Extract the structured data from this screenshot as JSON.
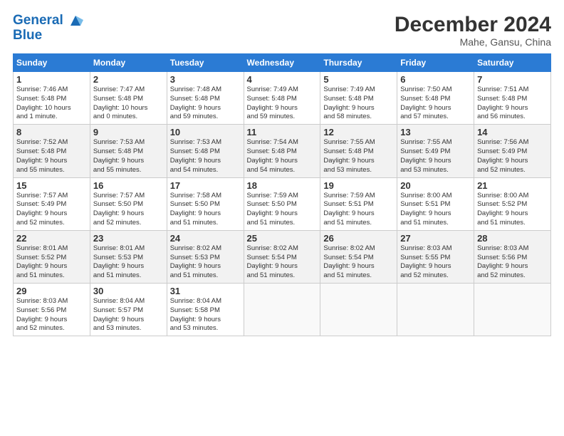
{
  "header": {
    "logo_line1": "General",
    "logo_line2": "Blue",
    "title": "December 2024",
    "location": "Mahe, Gansu, China"
  },
  "columns": [
    "Sunday",
    "Monday",
    "Tuesday",
    "Wednesday",
    "Thursday",
    "Friday",
    "Saturday"
  ],
  "weeks": [
    [
      {
        "day": "1",
        "info": "Sunrise: 7:46 AM\nSunset: 5:48 PM\nDaylight: 10 hours\nand 1 minute."
      },
      {
        "day": "2",
        "info": "Sunrise: 7:47 AM\nSunset: 5:48 PM\nDaylight: 10 hours\nand 0 minutes."
      },
      {
        "day": "3",
        "info": "Sunrise: 7:48 AM\nSunset: 5:48 PM\nDaylight: 9 hours\nand 59 minutes."
      },
      {
        "day": "4",
        "info": "Sunrise: 7:49 AM\nSunset: 5:48 PM\nDaylight: 9 hours\nand 59 minutes."
      },
      {
        "day": "5",
        "info": "Sunrise: 7:49 AM\nSunset: 5:48 PM\nDaylight: 9 hours\nand 58 minutes."
      },
      {
        "day": "6",
        "info": "Sunrise: 7:50 AM\nSunset: 5:48 PM\nDaylight: 9 hours\nand 57 minutes."
      },
      {
        "day": "7",
        "info": "Sunrise: 7:51 AM\nSunset: 5:48 PM\nDaylight: 9 hours\nand 56 minutes."
      }
    ],
    [
      {
        "day": "8",
        "info": "Sunrise: 7:52 AM\nSunset: 5:48 PM\nDaylight: 9 hours\nand 55 minutes."
      },
      {
        "day": "9",
        "info": "Sunrise: 7:53 AM\nSunset: 5:48 PM\nDaylight: 9 hours\nand 55 minutes."
      },
      {
        "day": "10",
        "info": "Sunrise: 7:53 AM\nSunset: 5:48 PM\nDaylight: 9 hours\nand 54 minutes."
      },
      {
        "day": "11",
        "info": "Sunrise: 7:54 AM\nSunset: 5:48 PM\nDaylight: 9 hours\nand 54 minutes."
      },
      {
        "day": "12",
        "info": "Sunrise: 7:55 AM\nSunset: 5:48 PM\nDaylight: 9 hours\nand 53 minutes."
      },
      {
        "day": "13",
        "info": "Sunrise: 7:55 AM\nSunset: 5:49 PM\nDaylight: 9 hours\nand 53 minutes."
      },
      {
        "day": "14",
        "info": "Sunrise: 7:56 AM\nSunset: 5:49 PM\nDaylight: 9 hours\nand 52 minutes."
      }
    ],
    [
      {
        "day": "15",
        "info": "Sunrise: 7:57 AM\nSunset: 5:49 PM\nDaylight: 9 hours\nand 52 minutes."
      },
      {
        "day": "16",
        "info": "Sunrise: 7:57 AM\nSunset: 5:50 PM\nDaylight: 9 hours\nand 52 minutes."
      },
      {
        "day": "17",
        "info": "Sunrise: 7:58 AM\nSunset: 5:50 PM\nDaylight: 9 hours\nand 51 minutes."
      },
      {
        "day": "18",
        "info": "Sunrise: 7:59 AM\nSunset: 5:50 PM\nDaylight: 9 hours\nand 51 minutes."
      },
      {
        "day": "19",
        "info": "Sunrise: 7:59 AM\nSunset: 5:51 PM\nDaylight: 9 hours\nand 51 minutes."
      },
      {
        "day": "20",
        "info": "Sunrise: 8:00 AM\nSunset: 5:51 PM\nDaylight: 9 hours\nand 51 minutes."
      },
      {
        "day": "21",
        "info": "Sunrise: 8:00 AM\nSunset: 5:52 PM\nDaylight: 9 hours\nand 51 minutes."
      }
    ],
    [
      {
        "day": "22",
        "info": "Sunrise: 8:01 AM\nSunset: 5:52 PM\nDaylight: 9 hours\nand 51 minutes."
      },
      {
        "day": "23",
        "info": "Sunrise: 8:01 AM\nSunset: 5:53 PM\nDaylight: 9 hours\nand 51 minutes."
      },
      {
        "day": "24",
        "info": "Sunrise: 8:02 AM\nSunset: 5:53 PM\nDaylight: 9 hours\nand 51 minutes."
      },
      {
        "day": "25",
        "info": "Sunrise: 8:02 AM\nSunset: 5:54 PM\nDaylight: 9 hours\nand 51 minutes."
      },
      {
        "day": "26",
        "info": "Sunrise: 8:02 AM\nSunset: 5:54 PM\nDaylight: 9 hours\nand 51 minutes."
      },
      {
        "day": "27",
        "info": "Sunrise: 8:03 AM\nSunset: 5:55 PM\nDaylight: 9 hours\nand 52 minutes."
      },
      {
        "day": "28",
        "info": "Sunrise: 8:03 AM\nSunset: 5:56 PM\nDaylight: 9 hours\nand 52 minutes."
      }
    ],
    [
      {
        "day": "29",
        "info": "Sunrise: 8:03 AM\nSunset: 5:56 PM\nDaylight: 9 hours\nand 52 minutes."
      },
      {
        "day": "30",
        "info": "Sunrise: 8:04 AM\nSunset: 5:57 PM\nDaylight: 9 hours\nand 53 minutes."
      },
      {
        "day": "31",
        "info": "Sunrise: 8:04 AM\nSunset: 5:58 PM\nDaylight: 9 hours\nand 53 minutes."
      },
      {
        "day": "",
        "info": ""
      },
      {
        "day": "",
        "info": ""
      },
      {
        "day": "",
        "info": ""
      },
      {
        "day": "",
        "info": ""
      }
    ]
  ]
}
